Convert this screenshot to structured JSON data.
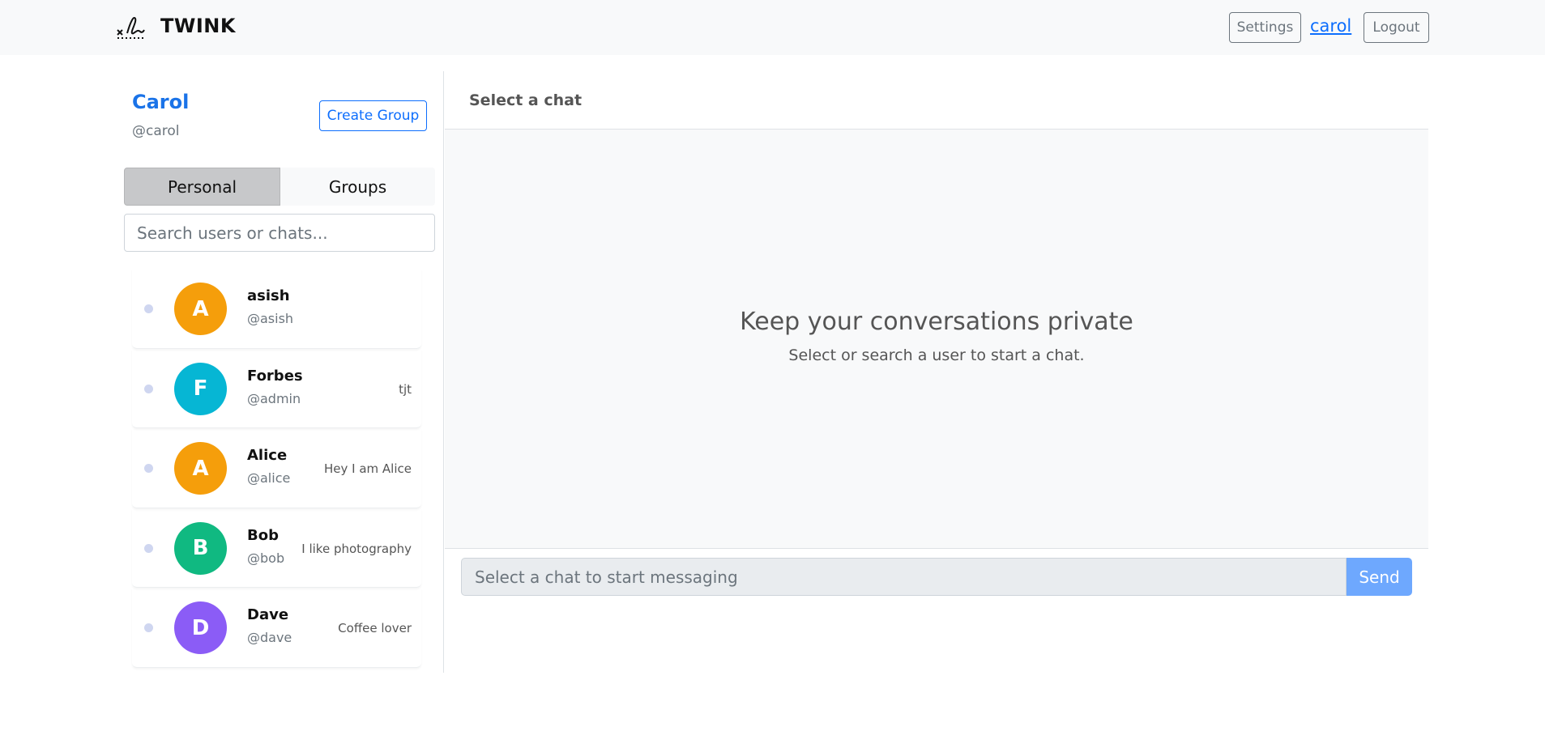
{
  "navbar": {
    "brand": "TWINK",
    "logo_icon": "signature-logo-icon",
    "settings_label": "Settings",
    "username_link": "carol",
    "logout_label": "Logout"
  },
  "sidebar": {
    "display_name": "Carol",
    "handle": "@carol",
    "create_group_label": "Create Group",
    "tabs": [
      {
        "label": "Personal",
        "active": true
      },
      {
        "label": "Groups",
        "active": false
      }
    ],
    "search_placeholder": "Search users or chats...",
    "contacts": [
      {
        "initial": "A",
        "name": "asish",
        "handle": "@asish",
        "last_message": "",
        "color": "#f59e0b"
      },
      {
        "initial": "F",
        "name": "Forbes",
        "handle": "@admin",
        "last_message": "tjt",
        "color": "#06b6d4"
      },
      {
        "initial": "A",
        "name": "Alice",
        "handle": "@alice",
        "last_message": "Hey I am Alice",
        "color": "#f59e0b"
      },
      {
        "initial": "B",
        "name": "Bob",
        "handle": "@bob",
        "last_message": "I like photography",
        "color": "#10b981"
      },
      {
        "initial": "D",
        "name": "Dave",
        "handle": "@dave",
        "last_message": "Coffee lover",
        "color": "#8b5cf6"
      }
    ]
  },
  "chat": {
    "header_title": "Select a chat",
    "empty_title": "Keep your conversations private",
    "empty_subtitle": "Select or search a user to start a chat.",
    "input_placeholder": "Select a chat to start messaging",
    "send_label": "Send"
  },
  "colors": {
    "accent": "#0d6efd",
    "brand_name_blue": "#1a73e8",
    "send_disabled": "#6ea8fe"
  }
}
